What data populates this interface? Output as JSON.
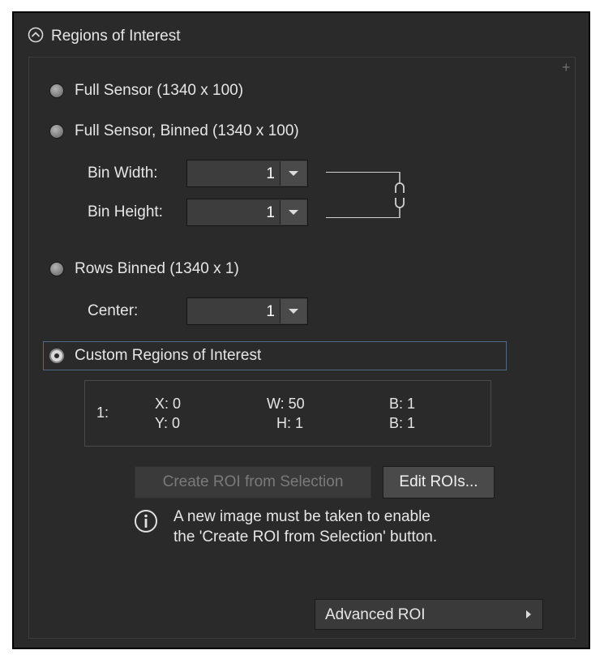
{
  "panel": {
    "title": "Regions of Interest"
  },
  "options": {
    "full_sensor": "Full Sensor (1340 x 100)",
    "full_sensor_binned": "Full Sensor, Binned (1340 x 100)",
    "rows_binned": "Rows Binned (1340 x 1)",
    "custom": "Custom Regions of Interest",
    "selected": "custom"
  },
  "binning": {
    "bin_width_label": "Bin Width:",
    "bin_width_value": "1",
    "bin_height_label": "Bin Height:",
    "bin_height_value": "1",
    "center_label": "Center:",
    "center_value": "1"
  },
  "roi_list": [
    {
      "index": "1:",
      "x": "X: 0",
      "y": "Y: 0",
      "w": "W: 50",
      "h": "H: 1",
      "b1": "B: 1",
      "b2": "B: 1"
    }
  ],
  "buttons": {
    "create_roi": "Create ROI from Selection",
    "edit_rois": "Edit ROIs...",
    "advanced_roi": "Advanced ROI"
  },
  "info": {
    "message": "A new image must be taken to enable the 'Create ROI from Selection' button."
  },
  "icons": {
    "collapse": "chevron-up-circle-icon",
    "add": "plus-icon",
    "link": "chain-link-icon",
    "info": "info-icon",
    "submenu": "caret-right-icon"
  },
  "colors": {
    "panel_bg": "#2a2a2a",
    "focus_border": "#4d6b86",
    "text": "#e6e6e6"
  }
}
